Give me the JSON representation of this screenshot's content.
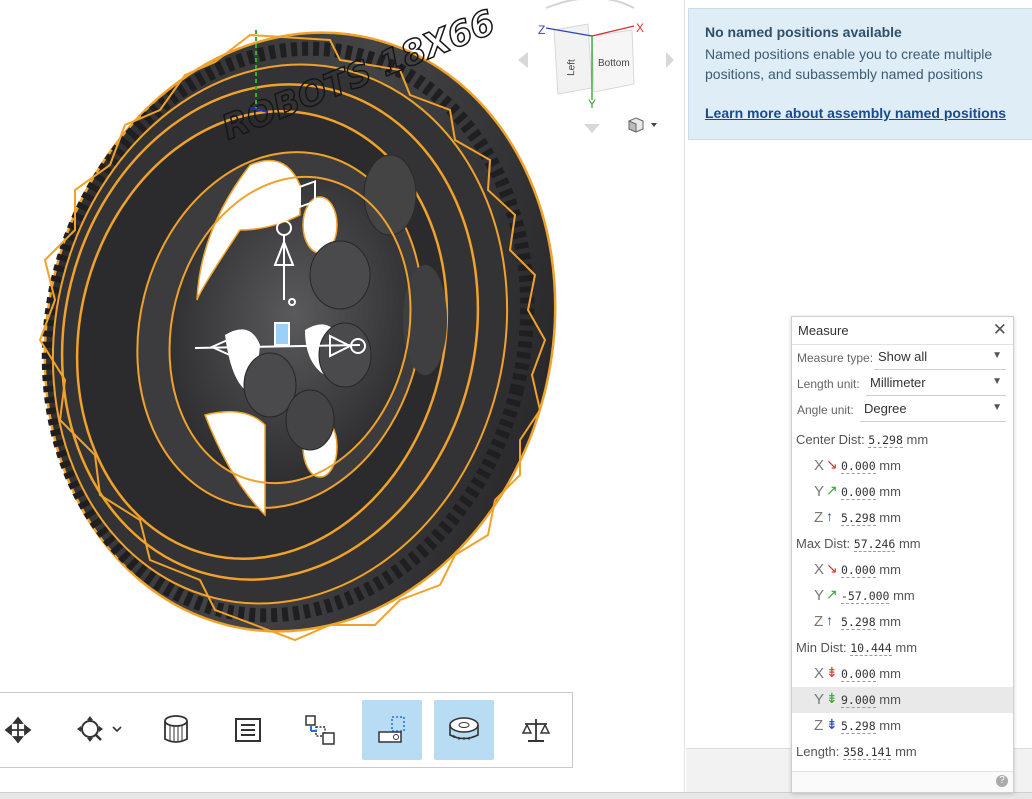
{
  "viewcube": {
    "axis_z": "Z",
    "axis_x": "X",
    "axis_y": "Y",
    "face_left": "Left",
    "face_bottom": "Bottom"
  },
  "wheel": {
    "tire_text": "ROBOTS 18X66"
  },
  "named_positions": {
    "title": "No named positions available",
    "description": "Named positions enable you to create multiple positions, and subassembly named positions",
    "link": "Learn more about assembly named positions"
  },
  "toolbar": {
    "items": [
      {
        "icon": "move-icon",
        "selected": false
      },
      {
        "icon": "zoom-icon",
        "selected": false
      },
      {
        "icon": "section-view-icon",
        "selected": false
      },
      {
        "icon": "list-icon",
        "selected": false
      },
      {
        "icon": "explode-icon",
        "selected": false
      },
      {
        "icon": "named-positions-icon",
        "selected": true
      },
      {
        "icon": "measure-tape-icon",
        "selected": true
      },
      {
        "icon": "mass-properties-icon",
        "selected": false
      }
    ]
  },
  "measure": {
    "title": "Measure",
    "measure_type_label": "Measure type:",
    "measure_type_value": "Show all",
    "length_unit_label": "Length unit:",
    "length_unit_value": "Millimeter",
    "angle_unit_label": "Angle unit:",
    "angle_unit_value": "Degree",
    "center": {
      "label": "Center Dist:",
      "value": "5.298",
      "unit": "mm",
      "x": "0.000",
      "y": "0.000",
      "z": "5.298"
    },
    "max": {
      "label": "Max Dist:",
      "value": "57.246",
      "unit": "mm",
      "x": "0.000",
      "y": "-57.000",
      "z": "5.298"
    },
    "min": {
      "label": "Min Dist:",
      "value": "10.444",
      "unit": "mm",
      "x": "0.000",
      "y": "9.000",
      "z": "5.298"
    },
    "length": {
      "label": "Length:",
      "value": "358.141",
      "unit": "mm"
    },
    "axis_x": "X",
    "axis_y": "Y",
    "axis_z": "Z",
    "colors": {
      "x": "#d9362c",
      "y": "#3aa335",
      "z": "#1f3fbf"
    }
  },
  "colors": {
    "selection": "#f0a22a",
    "tire": "#3a3a3c",
    "toolbar_selected": "#b9dcf5",
    "info_bg": "#dfeef6"
  }
}
